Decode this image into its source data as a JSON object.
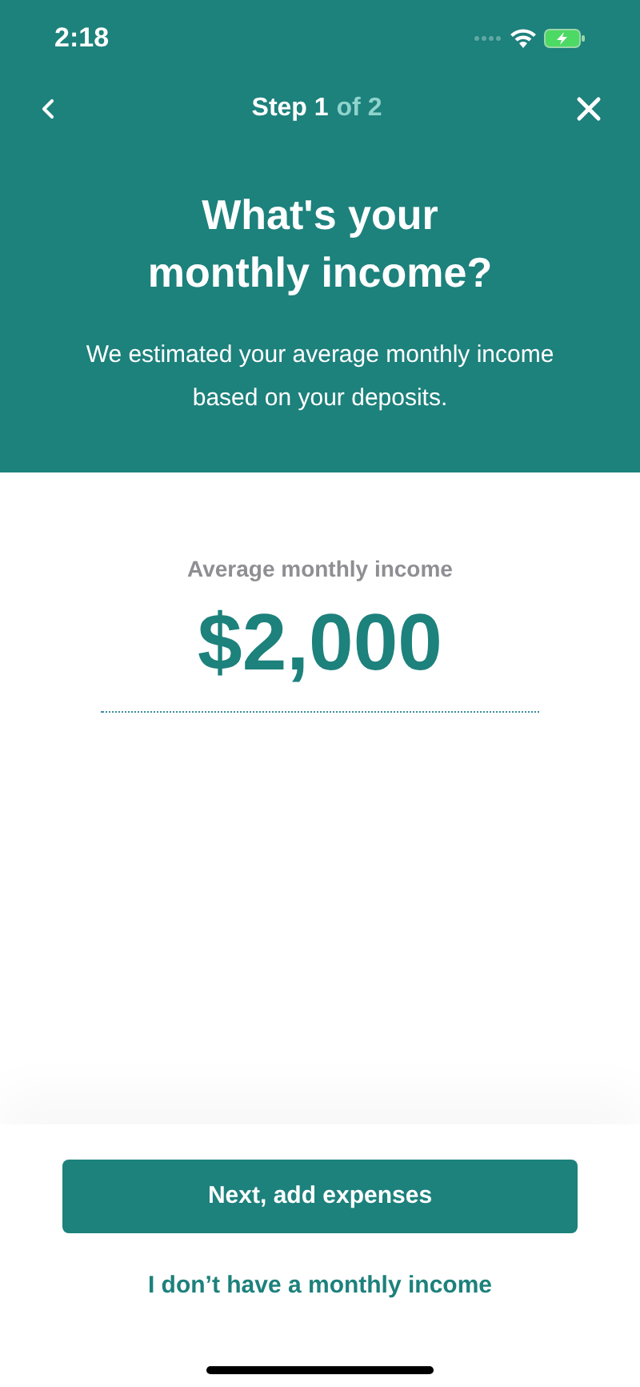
{
  "status_bar": {
    "time": "2:18"
  },
  "nav": {
    "step_label": "Step 1",
    "step_count": "of 2"
  },
  "header": {
    "title": "What's your monthly income?",
    "subtitle": "We estimated your average monthly income based on your deposits."
  },
  "income": {
    "label": "Average monthly income",
    "value": "$2,000"
  },
  "actions": {
    "primary": "Next, add expenses",
    "secondary": "I don’t have a monthly income"
  }
}
